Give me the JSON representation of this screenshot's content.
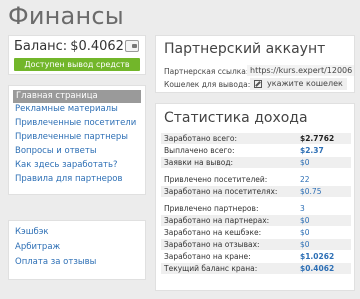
{
  "page": {
    "title": "Финансы"
  },
  "balance": {
    "label": "Баланс:",
    "value": "$0.4062",
    "withdraw_label": "Доступен вывод средств"
  },
  "nav": {
    "items": [
      {
        "label": "Главная страница",
        "active": true
      },
      {
        "label": "Рекламные материалы"
      },
      {
        "label": "Привлеченные посетители"
      },
      {
        "label": "Привлеченные партнеры"
      },
      {
        "label": "Вопросы и ответы"
      },
      {
        "label": "Как здесь заработать?"
      },
      {
        "label": "Правила для партнеров"
      }
    ]
  },
  "links": {
    "items": [
      {
        "label": "Кэшбэк"
      },
      {
        "label": "Арбитраж"
      },
      {
        "label": "Оплата за отзывы"
      }
    ]
  },
  "partner": {
    "title": "Партнерский аккаунт",
    "ref_label": "Партнерская ссылка:",
    "ref_value": "https://kurs.expert/12006",
    "wallet_label": "Кошелек для вывода:",
    "wallet_action": "укажите кошелек"
  },
  "stats": {
    "title": "Статистика дохода",
    "rows": [
      {
        "label": "Заработано всего:",
        "value": "$2.7762"
      },
      {
        "label": "Выплачено всего:",
        "value": "$2.37"
      },
      {
        "label": "Заявки на вывод:",
        "value": "$0"
      },
      {
        "label": "Привлечено посетителей:",
        "value": "22"
      },
      {
        "label": "Заработано на посетителях:",
        "value": "$0.75"
      },
      {
        "label": "Привлечено партнеров:",
        "value": "3"
      },
      {
        "label": "Заработано на партнерах:",
        "value": "$0"
      },
      {
        "label": "Заработано на кешбэке:",
        "value": "$0"
      },
      {
        "label": "Заработано на отзывах:",
        "value": "$0"
      },
      {
        "label": "Заработано на кране:",
        "value": "$1.0262"
      },
      {
        "label": "Текущий баланс крана:",
        "value": "$0.4062"
      }
    ]
  },
  "colors": {
    "accent_green": "#72b62a",
    "link_blue": "#2d6fb5",
    "active_nav_bg": "#9a9a9a"
  }
}
